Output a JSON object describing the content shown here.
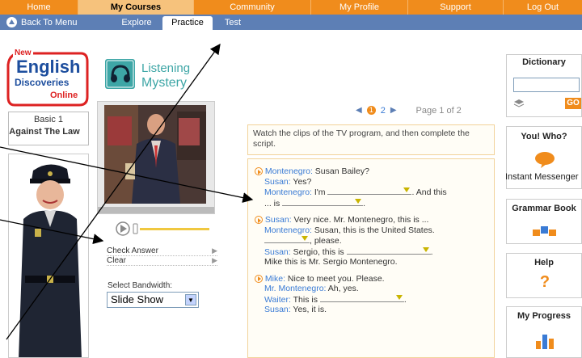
{
  "top_nav": [
    "Home",
    "My Courses",
    "Community",
    "My Profile",
    "Support",
    "Log Out"
  ],
  "top_nav_active": "My Courses",
  "sub_nav": {
    "back": "Back To Menu",
    "tabs": [
      "Explore",
      "Practice",
      "Test"
    ],
    "active": "Practice"
  },
  "logo": {
    "new": "New",
    "line1": "English",
    "line2": "Discoveries",
    "line3": "Online"
  },
  "level": {
    "name": "Basic 1",
    "unit": "Against The Law"
  },
  "activity": {
    "line1": "Listening",
    "line2": "Mystery"
  },
  "player": {
    "check_answer": "Check Answer",
    "clear": "Clear",
    "bandwidth_label": "Select Bandwidth:",
    "bandwidth_value": "Slide Show"
  },
  "pager": {
    "page1": "1",
    "page2": "2",
    "label": "Page 1 of 2"
  },
  "instructions": "Watch the clips of the TV program, and then complete the script.",
  "script": {
    "b1_l1_sp": "Montenegro:",
    "b1_l1": " Susan Bailey?",
    "b1_l2_sp": "Susan:",
    "b1_l2": " Yes?",
    "b1_l3_sp": "Montenegro:",
    "b1_l3a": " I'm ",
    "b1_l3b": ". And this",
    "b1_l4a": "... is ",
    "b1_l4b": ".",
    "b2_l1_sp": "Susan:",
    "b2_l1": " Very nice. Mr. Montenegro, this is ...",
    "b2_l2_sp": "Montenegro:",
    "b2_l2": " Susan, this is the United States.",
    "b2_l3": ", please.",
    "b2_l4_sp": "Susan:",
    "b2_l4a": " Sergio, this is ",
    "b2_l4b": ".",
    "b2_l5": "Mike this is Mr. Sergio Montenegro.",
    "b3_l1_sp": "Mike:",
    "b3_l1": " Nice to meet you. Please.",
    "b3_l2_sp": "Mr. Montenegro:",
    "b3_l2": " Ah, yes.",
    "b3_l3_sp": "Waiter:",
    "b3_l3a": " This is ",
    "b3_l3b": ".",
    "b3_l4_sp": "Susan:",
    "b3_l4": " Yes, it is."
  },
  "right_panel": {
    "dictionary": "Dictionary",
    "go": "GO",
    "you_who": "You! Who?",
    "messenger": "Instant Messenger",
    "grammar": "Grammar Book",
    "help": "Help",
    "progress": "My Progress"
  },
  "colors": {
    "orange": "#f08c1c",
    "blue_bar": "#5d7fb5",
    "teal": "#3ea6a6",
    "speaker": "#3a7bd5"
  }
}
